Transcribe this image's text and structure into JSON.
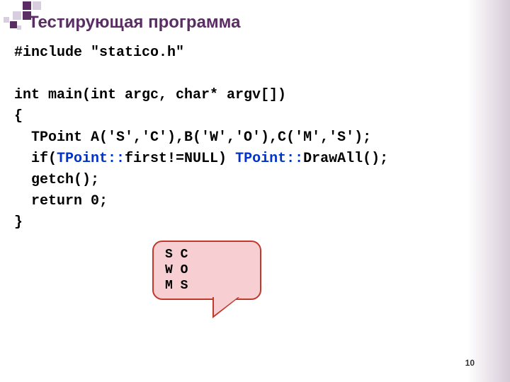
{
  "title": "Тестирующая программа",
  "code": {
    "l1": "#include \"statico.h\"",
    "l2": "",
    "l3": "int main(int argc, char* argv[])",
    "l4": "{",
    "l5": "  TPoint A('S','C'),B('W','O'),C('M','S');",
    "l6a": "  if(",
    "l6b": "TPoint::",
    "l6c": "first!=NULL) ",
    "l6d": "TPoint::",
    "l6e": "DrawAll();",
    "l7": "  getch();",
    "l8": "  return 0;",
    "l9": "}"
  },
  "output": "S C\nW O\nM S",
  "page": "10"
}
